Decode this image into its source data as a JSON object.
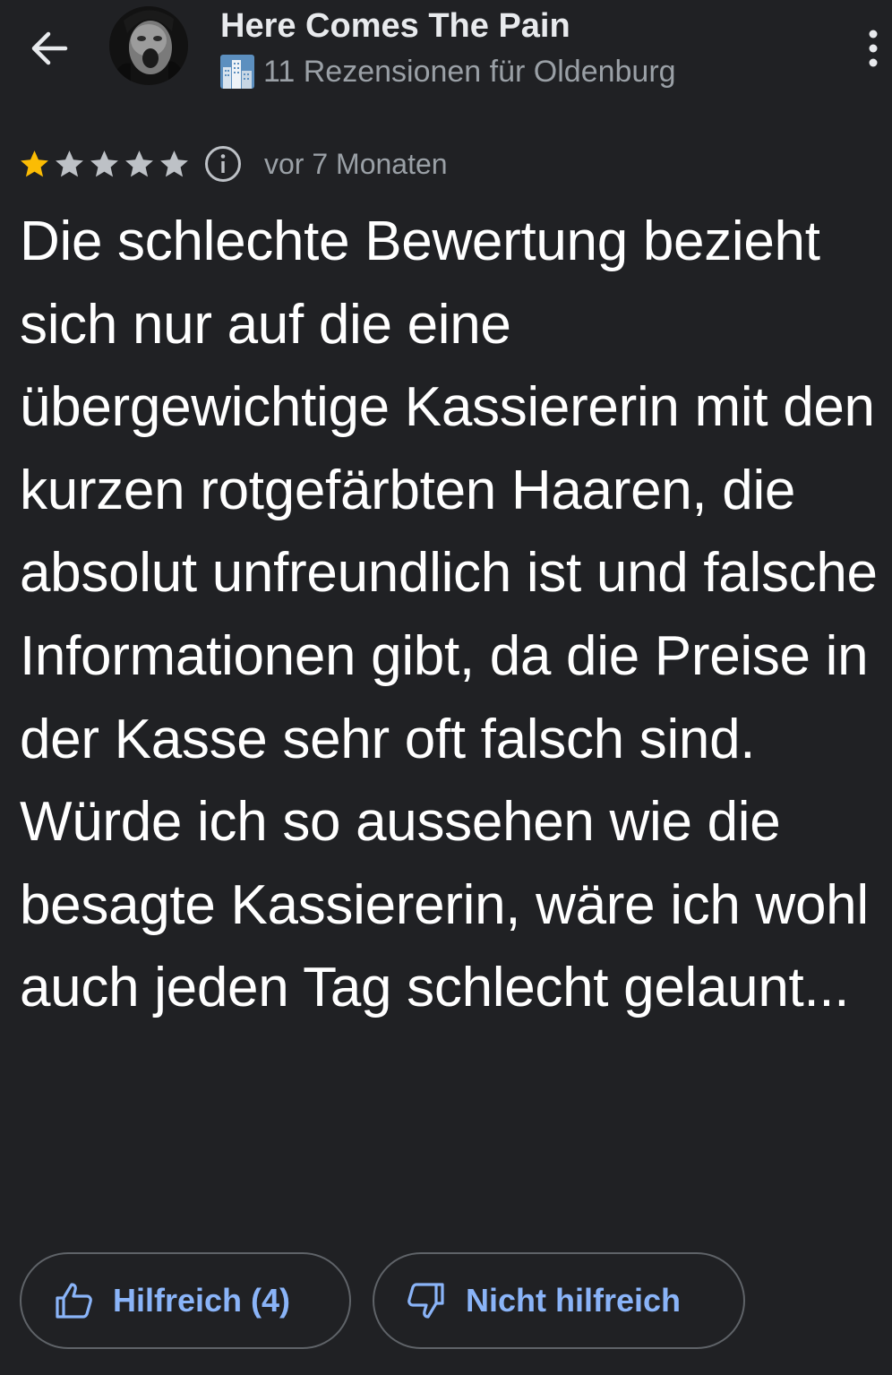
{
  "header": {
    "back_icon": "arrow-back-icon",
    "user_name": "Here Comes The Pain",
    "subline_icon": "city-icon",
    "review_count_text": "11 Rezensionen für Oldenburg",
    "more_icon": "more-vert-icon"
  },
  "review": {
    "rating": 1,
    "max_rating": 5,
    "date": "vor 7 Monaten",
    "text": "Die schlechte Bewertung bezieht sich nur auf die eine übergewichtige Kassiererin mit den kurzen rotgefärbten Haaren, die absolut unfreundlich ist und falsche Informationen gibt, da die Preise in der Kasse sehr oft falsch sind. Würde ich so aussehen wie die besagte Kassiererin, wäre ich wohl auch jeden Tag schlecht gelaunt..."
  },
  "actions": {
    "helpful_label": "Hilfreich (4)",
    "not_helpful_label": "Nicht hilfreich"
  },
  "colors": {
    "background": "#202124",
    "star_filled": "#fbbc04",
    "star_empty": "#bdc1c6",
    "accent": "#8ab4f8",
    "secondary_text": "#9aa0a6"
  }
}
